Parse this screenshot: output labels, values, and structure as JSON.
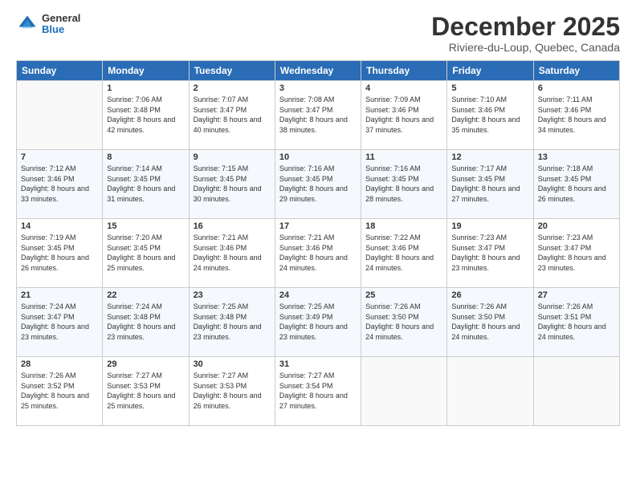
{
  "header": {
    "logo_general": "General",
    "logo_blue": "Blue",
    "month": "December 2025",
    "location": "Riviere-du-Loup, Quebec, Canada"
  },
  "weekdays": [
    "Sunday",
    "Monday",
    "Tuesday",
    "Wednesday",
    "Thursday",
    "Friday",
    "Saturday"
  ],
  "weeks": [
    [
      {
        "day": "",
        "sunrise": "",
        "sunset": "",
        "daylight": ""
      },
      {
        "day": "1",
        "sunrise": "Sunrise: 7:06 AM",
        "sunset": "Sunset: 3:48 PM",
        "daylight": "Daylight: 8 hours and 42 minutes."
      },
      {
        "day": "2",
        "sunrise": "Sunrise: 7:07 AM",
        "sunset": "Sunset: 3:47 PM",
        "daylight": "Daylight: 8 hours and 40 minutes."
      },
      {
        "day": "3",
        "sunrise": "Sunrise: 7:08 AM",
        "sunset": "Sunset: 3:47 PM",
        "daylight": "Daylight: 8 hours and 38 minutes."
      },
      {
        "day": "4",
        "sunrise": "Sunrise: 7:09 AM",
        "sunset": "Sunset: 3:46 PM",
        "daylight": "Daylight: 8 hours and 37 minutes."
      },
      {
        "day": "5",
        "sunrise": "Sunrise: 7:10 AM",
        "sunset": "Sunset: 3:46 PM",
        "daylight": "Daylight: 8 hours and 35 minutes."
      },
      {
        "day": "6",
        "sunrise": "Sunrise: 7:11 AM",
        "sunset": "Sunset: 3:46 PM",
        "daylight": "Daylight: 8 hours and 34 minutes."
      }
    ],
    [
      {
        "day": "7",
        "sunrise": "Sunrise: 7:12 AM",
        "sunset": "Sunset: 3:46 PM",
        "daylight": "Daylight: 8 hours and 33 minutes."
      },
      {
        "day": "8",
        "sunrise": "Sunrise: 7:14 AM",
        "sunset": "Sunset: 3:45 PM",
        "daylight": "Daylight: 8 hours and 31 minutes."
      },
      {
        "day": "9",
        "sunrise": "Sunrise: 7:15 AM",
        "sunset": "Sunset: 3:45 PM",
        "daylight": "Daylight: 8 hours and 30 minutes."
      },
      {
        "day": "10",
        "sunrise": "Sunrise: 7:16 AM",
        "sunset": "Sunset: 3:45 PM",
        "daylight": "Daylight: 8 hours and 29 minutes."
      },
      {
        "day": "11",
        "sunrise": "Sunrise: 7:16 AM",
        "sunset": "Sunset: 3:45 PM",
        "daylight": "Daylight: 8 hours and 28 minutes."
      },
      {
        "day": "12",
        "sunrise": "Sunrise: 7:17 AM",
        "sunset": "Sunset: 3:45 PM",
        "daylight": "Daylight: 8 hours and 27 minutes."
      },
      {
        "day": "13",
        "sunrise": "Sunrise: 7:18 AM",
        "sunset": "Sunset: 3:45 PM",
        "daylight": "Daylight: 8 hours and 26 minutes."
      }
    ],
    [
      {
        "day": "14",
        "sunrise": "Sunrise: 7:19 AM",
        "sunset": "Sunset: 3:45 PM",
        "daylight": "Daylight: 8 hours and 26 minutes."
      },
      {
        "day": "15",
        "sunrise": "Sunrise: 7:20 AM",
        "sunset": "Sunset: 3:45 PM",
        "daylight": "Daylight: 8 hours and 25 minutes."
      },
      {
        "day": "16",
        "sunrise": "Sunrise: 7:21 AM",
        "sunset": "Sunset: 3:46 PM",
        "daylight": "Daylight: 8 hours and 24 minutes."
      },
      {
        "day": "17",
        "sunrise": "Sunrise: 7:21 AM",
        "sunset": "Sunset: 3:46 PM",
        "daylight": "Daylight: 8 hours and 24 minutes."
      },
      {
        "day": "18",
        "sunrise": "Sunrise: 7:22 AM",
        "sunset": "Sunset: 3:46 PM",
        "daylight": "Daylight: 8 hours and 24 minutes."
      },
      {
        "day": "19",
        "sunrise": "Sunrise: 7:23 AM",
        "sunset": "Sunset: 3:47 PM",
        "daylight": "Daylight: 8 hours and 23 minutes."
      },
      {
        "day": "20",
        "sunrise": "Sunrise: 7:23 AM",
        "sunset": "Sunset: 3:47 PM",
        "daylight": "Daylight: 8 hours and 23 minutes."
      }
    ],
    [
      {
        "day": "21",
        "sunrise": "Sunrise: 7:24 AM",
        "sunset": "Sunset: 3:47 PM",
        "daylight": "Daylight: 8 hours and 23 minutes."
      },
      {
        "day": "22",
        "sunrise": "Sunrise: 7:24 AM",
        "sunset": "Sunset: 3:48 PM",
        "daylight": "Daylight: 8 hours and 23 minutes."
      },
      {
        "day": "23",
        "sunrise": "Sunrise: 7:25 AM",
        "sunset": "Sunset: 3:48 PM",
        "daylight": "Daylight: 8 hours and 23 minutes."
      },
      {
        "day": "24",
        "sunrise": "Sunrise: 7:25 AM",
        "sunset": "Sunset: 3:49 PM",
        "daylight": "Daylight: 8 hours and 23 minutes."
      },
      {
        "day": "25",
        "sunrise": "Sunrise: 7:26 AM",
        "sunset": "Sunset: 3:50 PM",
        "daylight": "Daylight: 8 hours and 24 minutes."
      },
      {
        "day": "26",
        "sunrise": "Sunrise: 7:26 AM",
        "sunset": "Sunset: 3:50 PM",
        "daylight": "Daylight: 8 hours and 24 minutes."
      },
      {
        "day": "27",
        "sunrise": "Sunrise: 7:26 AM",
        "sunset": "Sunset: 3:51 PM",
        "daylight": "Daylight: 8 hours and 24 minutes."
      }
    ],
    [
      {
        "day": "28",
        "sunrise": "Sunrise: 7:26 AM",
        "sunset": "Sunset: 3:52 PM",
        "daylight": "Daylight: 8 hours and 25 minutes."
      },
      {
        "day": "29",
        "sunrise": "Sunrise: 7:27 AM",
        "sunset": "Sunset: 3:53 PM",
        "daylight": "Daylight: 8 hours and 25 minutes."
      },
      {
        "day": "30",
        "sunrise": "Sunrise: 7:27 AM",
        "sunset": "Sunset: 3:53 PM",
        "daylight": "Daylight: 8 hours and 26 minutes."
      },
      {
        "day": "31",
        "sunrise": "Sunrise: 7:27 AM",
        "sunset": "Sunset: 3:54 PM",
        "daylight": "Daylight: 8 hours and 27 minutes."
      },
      {
        "day": "",
        "sunrise": "",
        "sunset": "",
        "daylight": ""
      },
      {
        "day": "",
        "sunrise": "",
        "sunset": "",
        "daylight": ""
      },
      {
        "day": "",
        "sunrise": "",
        "sunset": "",
        "daylight": ""
      }
    ]
  ]
}
